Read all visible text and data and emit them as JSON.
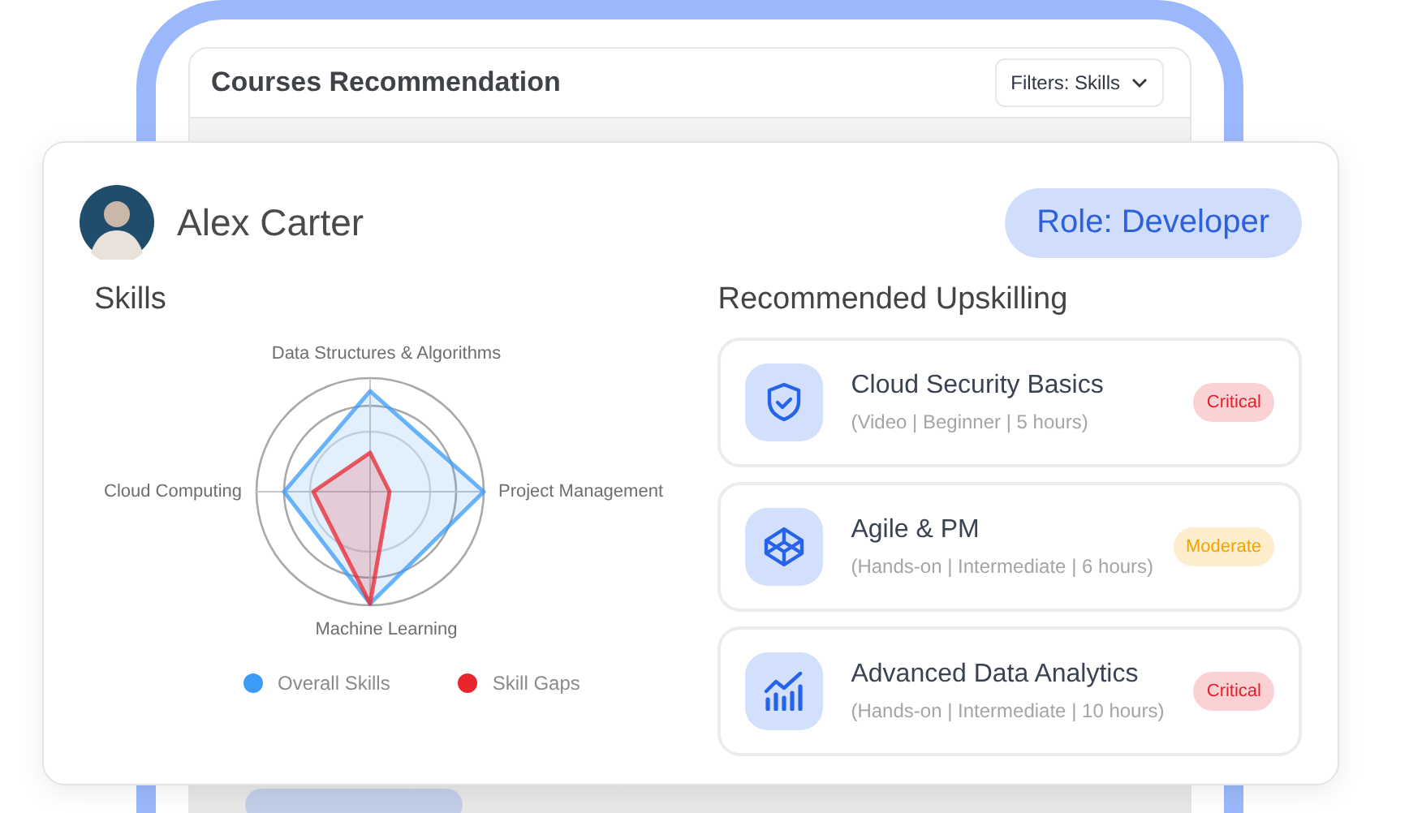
{
  "background_panel": {
    "title": "Courses Recommendation",
    "filter_button": "Filters: Skills"
  },
  "profile": {
    "name": "Alex Carter",
    "role": "Role: Developer"
  },
  "skills": {
    "title": "Skills",
    "axes": [
      "Data Structures & Algorithms",
      "Project Management",
      "Machine Learning",
      "Cloud Computing"
    ],
    "legend": [
      {
        "name": "Overall Skills",
        "color": "#3b9bf7"
      },
      {
        "name": "Skill Gaps",
        "color": "#e8262e"
      }
    ]
  },
  "upskilling": {
    "title": "Recommended Upskilling",
    "courses": [
      {
        "kind": "shield",
        "title": "Cloud Security Basics",
        "details": "(Video | Beginner | 5 hours)",
        "badge": "Critical",
        "color": "#e51e2a"
      },
      {
        "kind": "cube",
        "title": "Agile & PM",
        "details": "(Hands-on | Intermediate | 6 hours)",
        "badge": "Moderate",
        "color": "#f0a400"
      },
      {
        "kind": "chart",
        "title": "Advanced Data Analytics",
        "details": "(Hands-on | Intermediate | 10 hours)",
        "badge": "Critical",
        "color": "#e51e2a"
      }
    ]
  }
}
